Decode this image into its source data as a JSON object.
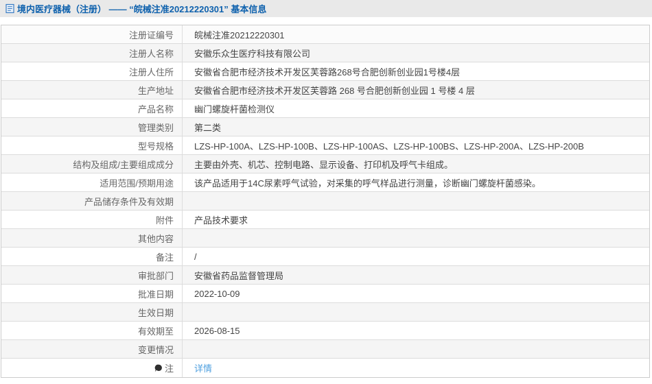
{
  "header": {
    "icon": "document-icon",
    "title": "境内医疗器械（注册） —— “皖械注准20212220301” 基本信息"
  },
  "table": {
    "rows": [
      {
        "label": "注册证编号",
        "value": "皖械注准20212220301"
      },
      {
        "label": "注册人名称",
        "value": "安徽乐众生医疗科技有限公司"
      },
      {
        "label": "注册人住所",
        "value": "安徽省合肥市经济技术开发区芙蓉路268号合肥创新创业园1号楼4层"
      },
      {
        "label": "生产地址",
        "value": "安徽省合肥市经济技术开发区芙蓉路 268 号合肥创新创业园 1 号楼 4 层"
      },
      {
        "label": "产品名称",
        "value": "幽门螺旋杆菌检测仪"
      },
      {
        "label": "管理类别",
        "value": "第二类"
      },
      {
        "label": "型号规格",
        "value": "LZS-HP-100A、LZS-HP-100B、LZS-HP-100AS、LZS-HP-100BS、LZS-HP-200A、LZS-HP-200B"
      },
      {
        "label": "结构及组成/主要组成成分",
        "value": "主要由外壳、机芯、控制电路、显示设备、打印机及呼气卡组成。"
      },
      {
        "label": "适用范围/预期用途",
        "value": "该产品适用于14C尿素呼气试验，对采集的呼气样品进行测量，诊断幽门螺旋杆菌感染。"
      },
      {
        "label": "产品储存条件及有效期",
        "value": ""
      },
      {
        "label": "附件",
        "value": "产品技术要求"
      },
      {
        "label": "其他内容",
        "value": ""
      },
      {
        "label": "备注",
        "value": "/"
      },
      {
        "label": "审批部门",
        "value": "安徽省药品监督管理局"
      },
      {
        "label": "批准日期",
        "value": "2022-10-09"
      },
      {
        "label": "生效日期",
        "value": ""
      },
      {
        "label": "有效期至",
        "value": "2026-08-15"
      },
      {
        "label": "变更情况",
        "value": ""
      },
      {
        "label": "注",
        "value": "详情",
        "label_icon": "note-balloon-icon",
        "value_is_link": true
      }
    ]
  },
  "colors": {
    "header_bg": "#e9e9e9",
    "header_text": "#0e61ad",
    "table_border": "#cccccc",
    "row_border": "#dcdcdc",
    "row_alt_bg": "#f5f5f5",
    "first_row_bg": "#fbfbfb",
    "label_text": "#666666",
    "value_text": "#444444",
    "link": "#4e9fdf"
  }
}
